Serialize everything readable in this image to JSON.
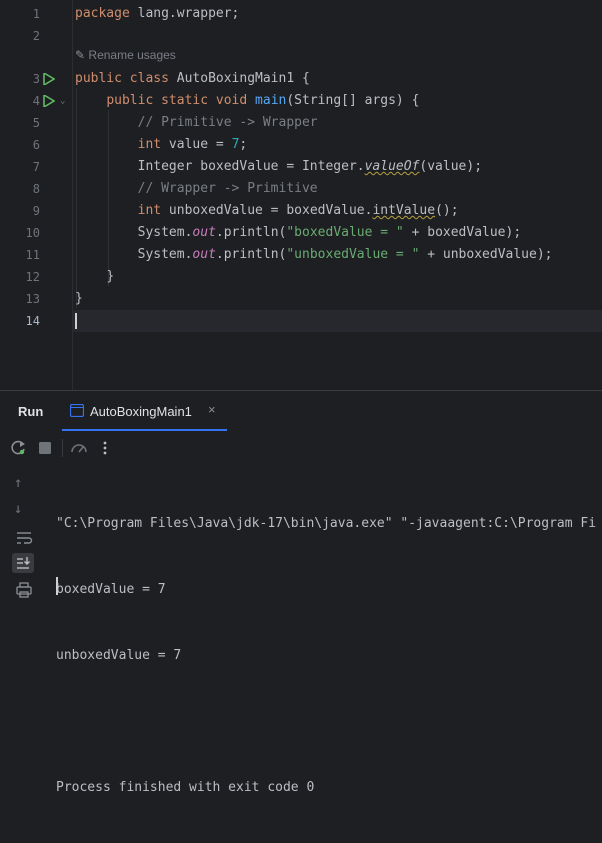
{
  "editor": {
    "line_numbers": [
      "1",
      "2",
      "3",
      "4",
      "5",
      "6",
      "7",
      "8",
      "9",
      "10",
      "11",
      "12",
      "13",
      "14"
    ],
    "inlay_hint": "Rename usages",
    "lines": {
      "l1_kw": "package",
      "l1_rest": " lang.wrapper;",
      "l3_kw1": "public",
      "l3_kw2": "class",
      "l3_rest": " AutoBoxingMain1 {",
      "l4_kw1": "public",
      "l4_kw2": "static",
      "l4_kw3": "void",
      "l4_fn": "main",
      "l4_rest": "(String[] args) {",
      "l5_comment": "// Primitive -> Wrapper",
      "l6_kw": "int",
      "l6_mid": " value = ",
      "l6_num": "7",
      "l6_end": ";",
      "l7_pre": "Integer boxedValue = Integer.",
      "l7_method": "valueOf",
      "l7_post": "(value);",
      "l8_comment": "// Wrapper -> Primitive",
      "l9_kw": "int",
      "l9_mid": " unboxedValue = boxedValue.",
      "l9_method": "intValue",
      "l9_post": "();",
      "l10_pre": "System.",
      "l10_out": "out",
      "l10_mid": ".println(",
      "l10_str": "\"boxedValue = \"",
      "l10_post": " + boxedValue);",
      "l11_pre": "System.",
      "l11_out": "out",
      "l11_mid": ".println(",
      "l11_str": "\"unboxedValue = \"",
      "l11_post": " + unboxedValue);",
      "l12": "}",
      "l13": "}"
    }
  },
  "run_panel": {
    "title": "Run",
    "tab_label": "AutoBoxingMain1",
    "tab_close": "×",
    "console_lines": [
      "\"C:\\Program Files\\Java\\jdk-17\\bin\\java.exe\" \"-javaagent:C:\\Program Fi",
      "boxedValue = 7",
      "unboxedValue = 7",
      "",
      "Process finished with exit code 0"
    ]
  },
  "icons": {
    "run_gutter": "run-triangle-icon",
    "rerun": "rerun-icon",
    "stop": "stop-icon",
    "coverage": "coverage-icon",
    "more": "more-vertical-icon",
    "up": "arrow-up-icon",
    "down": "arrow-down-icon",
    "soft_wrap": "soft-wrap-icon",
    "scroll_end": "scroll-to-end-icon",
    "print": "print-icon"
  },
  "colors": {
    "keyword": "#cf8e6d",
    "function": "#56a8f5",
    "string": "#6aab73",
    "number": "#2aacb8",
    "comment": "#7a7e85",
    "static_field": "#c77dbb",
    "accent": "#3574f0",
    "run_green": "#5fb865"
  }
}
